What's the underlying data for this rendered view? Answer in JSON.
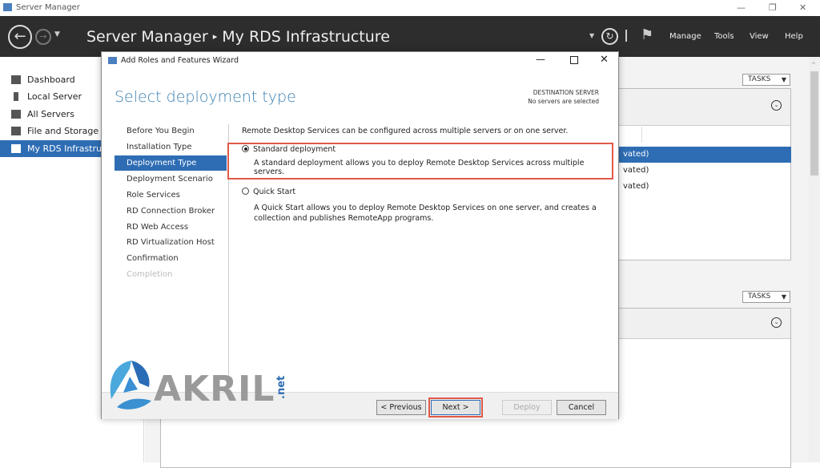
{
  "window": {
    "title": "Server Manager",
    "minimize": "—",
    "restore": "❐",
    "close": "✕"
  },
  "header": {
    "crumb_root": "Server Manager",
    "crumb_sep": "▸",
    "crumb_page": "My RDS Infrastructure",
    "menus": [
      "Manage",
      "Tools",
      "View",
      "Help"
    ]
  },
  "sidebar": {
    "items": [
      {
        "label": "Dashboard",
        "icon": "dashboard-icon"
      },
      {
        "label": "Local Server",
        "icon": "server-icon"
      },
      {
        "label": "All Servers",
        "icon": "servers-icon"
      },
      {
        "label": "File and Storage Services",
        "icon": "storage-icon"
      },
      {
        "label": "My RDS Infrastructure",
        "icon": "rds-icon",
        "selected": true
      }
    ]
  },
  "main": {
    "tasks_label": "TASKS",
    "rows": [
      "vated)",
      "vated)",
      "vated)"
    ]
  },
  "dialog": {
    "title": "Add Roles and Features Wizard",
    "heading": "Select deployment type",
    "dest_label": "DESTINATION SERVER",
    "dest_value": "No servers are selected",
    "nav": [
      {
        "label": "Before You Begin"
      },
      {
        "label": "Installation Type"
      },
      {
        "label": "Deployment Type",
        "selected": true
      },
      {
        "label": "Deployment Scenario"
      },
      {
        "label": "Role Services"
      },
      {
        "label": "RD Connection Broker"
      },
      {
        "label": "RD Web Access"
      },
      {
        "label": "RD Virtualization Host"
      },
      {
        "label": "Confirmation"
      },
      {
        "label": "Completion",
        "disabled": true
      }
    ],
    "intro": "Remote Desktop Services can be configured across multiple servers or on one server.",
    "options": [
      {
        "label": "Standard deployment",
        "desc": "A standard deployment allows you to deploy Remote Desktop Services across multiple servers.",
        "checked": true
      },
      {
        "label": "Quick Start",
        "desc": "A Quick Start allows you to deploy Remote Desktop Services on one server, and creates a collection and publishes RemoteApp programs.",
        "checked": false
      }
    ],
    "buttons": {
      "previous": "< Previous",
      "next": "Next >",
      "deploy": "Deploy",
      "cancel": "Cancel"
    }
  },
  "watermark": {
    "text": "AKRIL",
    "suffix": ".net"
  },
  "colors": {
    "selection": "#2e6db4",
    "highlight": "#e05a47",
    "header": "#2d2d2d"
  }
}
